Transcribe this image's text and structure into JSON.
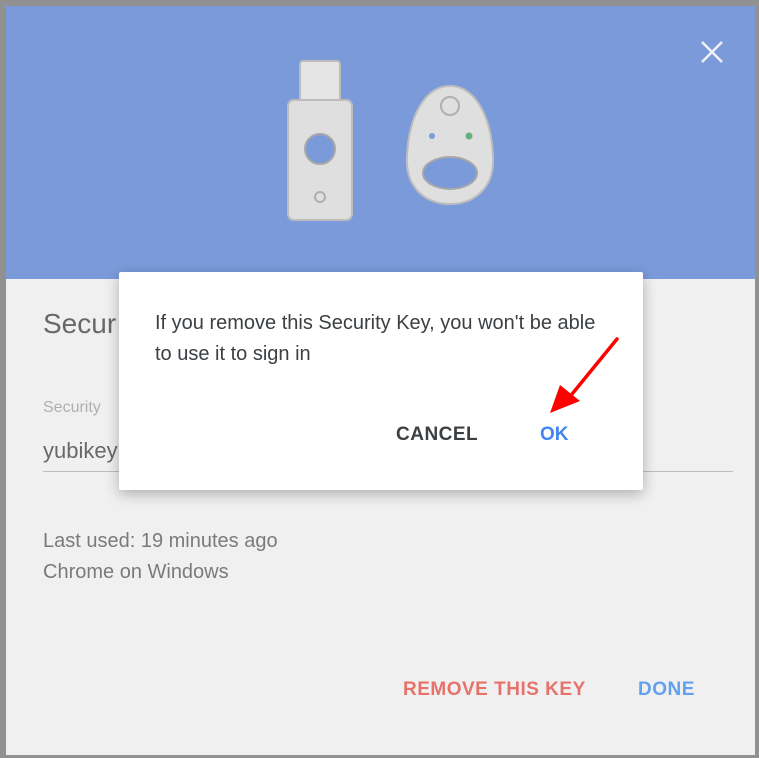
{
  "background_dialog": {
    "title": "Secur",
    "field_label": "Security",
    "field_value": "yubikey",
    "last_used": "Last used: 19 minutes ago",
    "last_used_device": "Chrome on Windows",
    "remove_label": "REMOVE THIS KEY",
    "done_label": "DONE"
  },
  "confirm_dialog": {
    "message": "If you remove this Security Key, you won't be able to use it to sign in",
    "cancel_label": "CANCEL",
    "ok_label": "OK"
  },
  "colors": {
    "header": "#3b6ac8",
    "remove": "#d93025",
    "done": "#1a73e8",
    "ok": "#4285f4",
    "annotation_arrow": "#ff0000"
  },
  "icons": {
    "close": "close-icon",
    "usb_key": "usb-security-key-icon",
    "fob_key": "fob-security-key-icon",
    "arrow": "annotation-arrow"
  }
}
